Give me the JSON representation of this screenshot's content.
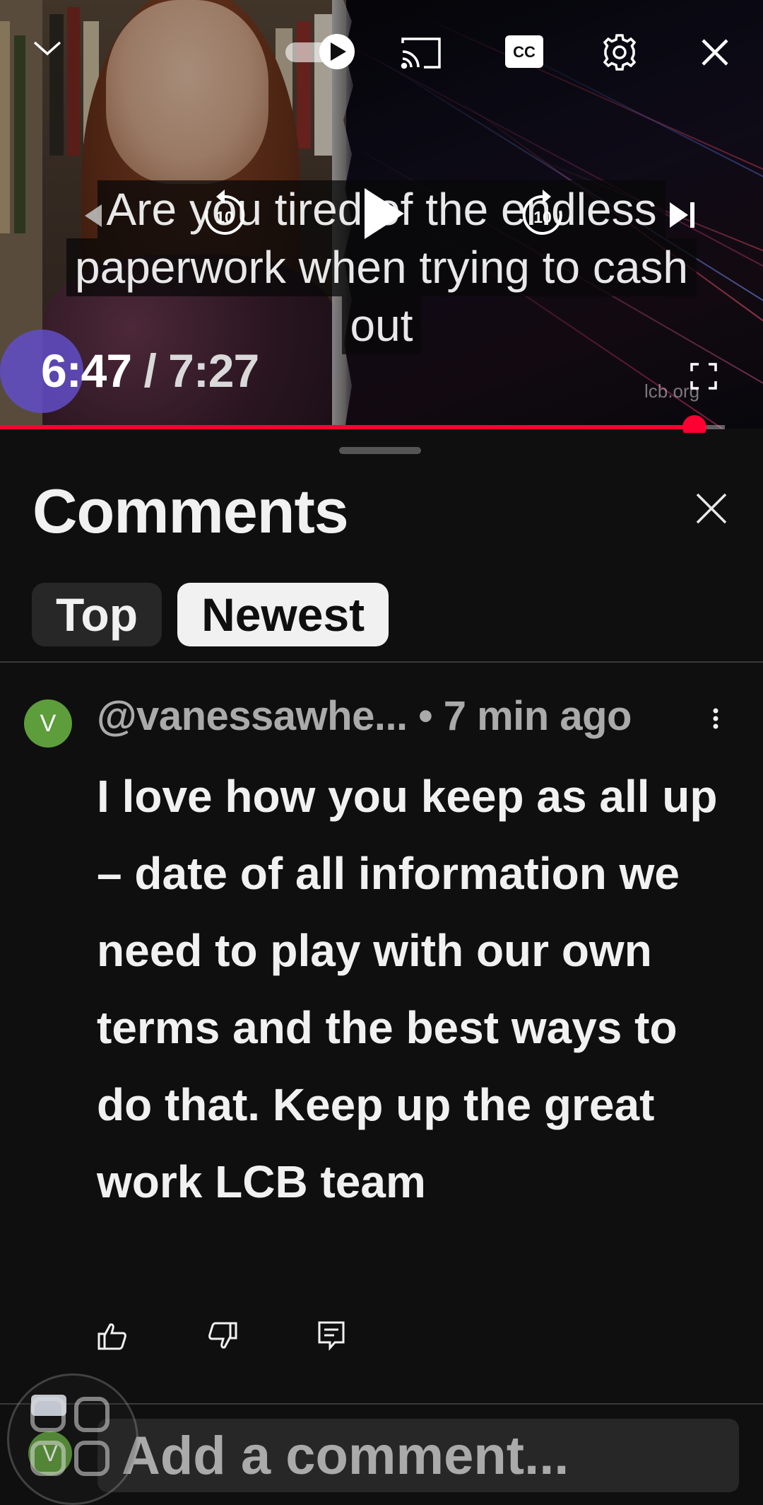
{
  "player": {
    "caption_lines": [
      "Are you tired of the endless",
      "paperwork when trying to cash",
      "out"
    ],
    "time_current": "6:47",
    "time_separator": " / ",
    "time_duration": "7:27",
    "watermark": "lcb.org",
    "progress_fraction": 0.91,
    "buffered_fraction": 0.95,
    "accent_color": "#ff0033",
    "icons": {
      "collapse": "chevron-down-icon",
      "autoplay": "autoplay-toggle-icon",
      "cast": "cast-icon",
      "captions": "cc-icon",
      "settings": "gear-icon",
      "close": "close-icon",
      "prev": "previous-icon",
      "rewind": "rewind-10-icon",
      "play": "play-icon",
      "forward": "forward-10-icon",
      "next": "next-icon",
      "fullscreen": "fullscreen-icon"
    },
    "seek_label": "10"
  },
  "comments_sheet": {
    "title": "Comments",
    "tabs": [
      {
        "label": "Top",
        "selected": false
      },
      {
        "label": "Newest",
        "selected": true
      }
    ],
    "comment": {
      "avatar_letter": "V",
      "author": "@vanessawhe...",
      "separator": " • ",
      "time": "7 min ago",
      "body": "I love how you keep as all up – date of all information we need to play with our own terms and the best ways to do that. Keep up the great work LCB team"
    },
    "footer": {
      "avatar_letter": "V",
      "placeholder": "Add a comment..."
    }
  }
}
